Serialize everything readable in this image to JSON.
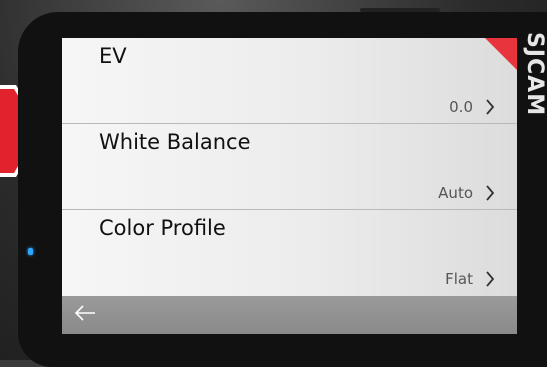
{
  "brand": "SJCAM",
  "menu": {
    "items": [
      {
        "label": "EV",
        "value": "0.0"
      },
      {
        "label": "White Balance",
        "value": "Auto"
      },
      {
        "label": "Color Profile",
        "value": "Flat"
      }
    ]
  },
  "icons": {
    "back": "arrow-left-icon",
    "chevron": "chevron-right-icon"
  },
  "colors": {
    "accent": "#e8343c",
    "screen_bg": "#eeeeee",
    "bottom_bar": "#8e8e8e"
  }
}
